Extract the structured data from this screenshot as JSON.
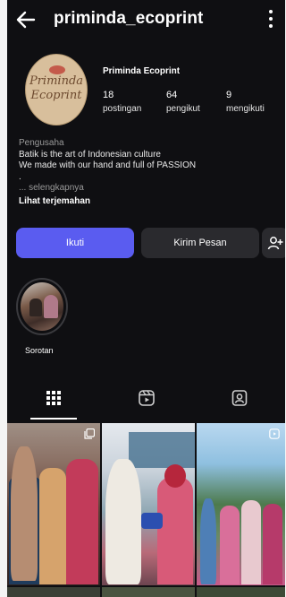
{
  "header": {
    "username": "priminda_ecoprint",
    "back_icon": "arrow-left-icon",
    "menu_icon": "more-vertical-icon"
  },
  "profile": {
    "avatar_text_line1": "Priminda",
    "avatar_text_line2": "Ecoprint",
    "display_name": "Priminda Ecoprint",
    "stats": {
      "posts_count": "18",
      "posts_label": "postingan",
      "followers_count": "64",
      "followers_label": "pengikut",
      "following_count": "9",
      "following_label": "mengikuti"
    }
  },
  "bio": {
    "category": "Pengusaha",
    "line1": "Batik is the art of Indonesian culture",
    "line2": "We made with our hand and full of PASSION",
    "line3": ".",
    "more": "... selengkapnya",
    "translate": "Lihat terjemahan"
  },
  "actions": {
    "follow_label": "Ikuti",
    "message_label": "Kirim Pesan",
    "add_user_icon": "add-person-icon"
  },
  "highlights": [
    {
      "label": "Sorotan"
    }
  ],
  "tabs": [
    {
      "icon": "grid-icon",
      "active": true
    },
    {
      "icon": "reels-icon",
      "active": false
    },
    {
      "icon": "tagged-icon",
      "active": false
    }
  ],
  "colors": {
    "background": "#0f0f12",
    "follow_button": "#5a5cf0",
    "secondary_button": "#2a2a2e"
  }
}
